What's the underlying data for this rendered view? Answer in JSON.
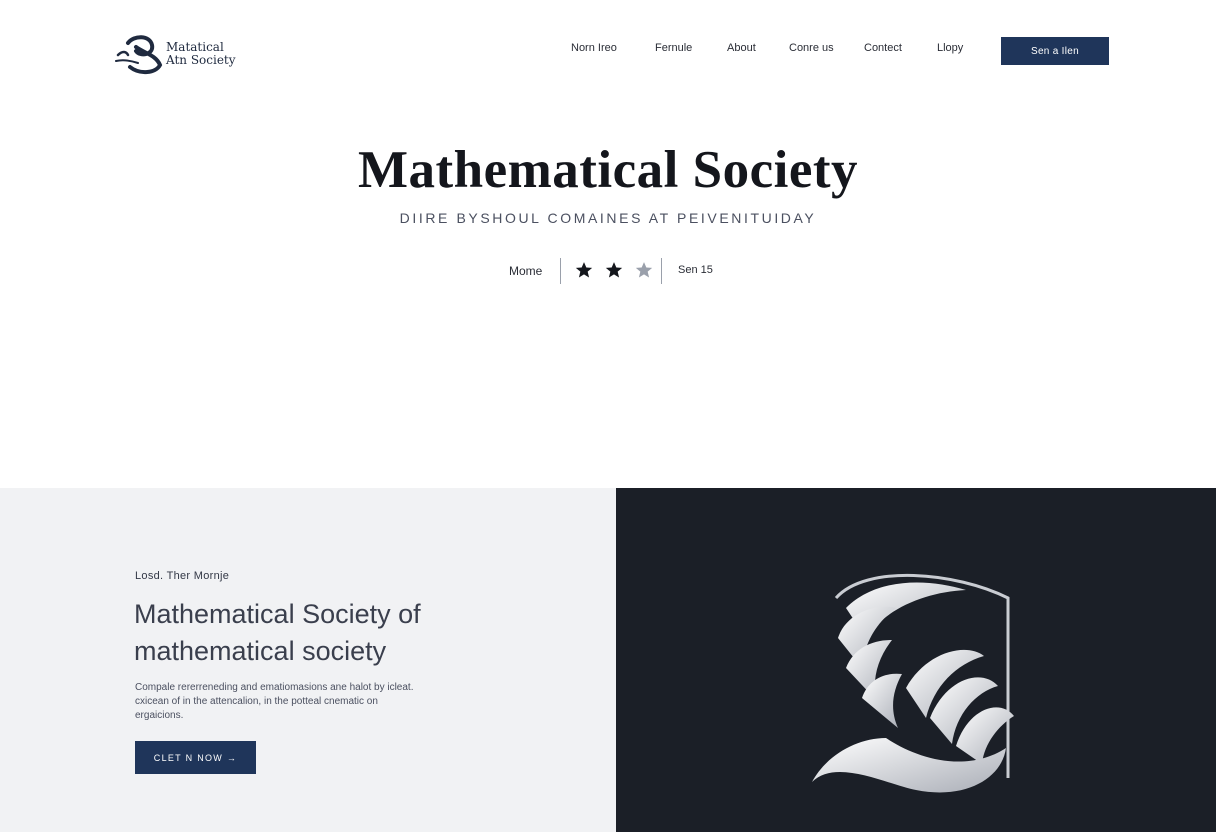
{
  "brand": {
    "line1": "Matatical",
    "line2": "Atn Society"
  },
  "nav": {
    "items": [
      {
        "label": "Norn Ireo"
      },
      {
        "label": "Fernule"
      },
      {
        "label": "About"
      },
      {
        "label": "Conre us"
      },
      {
        "label": "Contect"
      },
      {
        "label": "Llopy"
      }
    ],
    "cta_label": "Sen a   Ilen"
  },
  "hero": {
    "title": "Mathematical Society",
    "subtitle": "DIIRE BYSHOUL COMAINES AT PEIVENITUIDAY",
    "meta_left": "Mome",
    "rating": 2,
    "rating_max": 3,
    "meta_right": "Sen 15"
  },
  "feature": {
    "eyebrow": "Losd. Ther Mornje",
    "title_line1": "Mathematical Society of",
    "title_line2": "mathematical society",
    "body_line1": "Compale rererreneding and ematiomasions ane halot by icleat.",
    "body_line2": "cxicean of in the attencalion, in the potteal cnematic on",
    "body_line3": "ergaicions.",
    "cta_label": "CLET N NOW →"
  },
  "colors": {
    "accent": "#1f355a",
    "dark_panel": "#1b1f27",
    "light_panel": "#f1f2f4",
    "star_filled": "#14161c",
    "star_empty": "#9aa0ab"
  }
}
